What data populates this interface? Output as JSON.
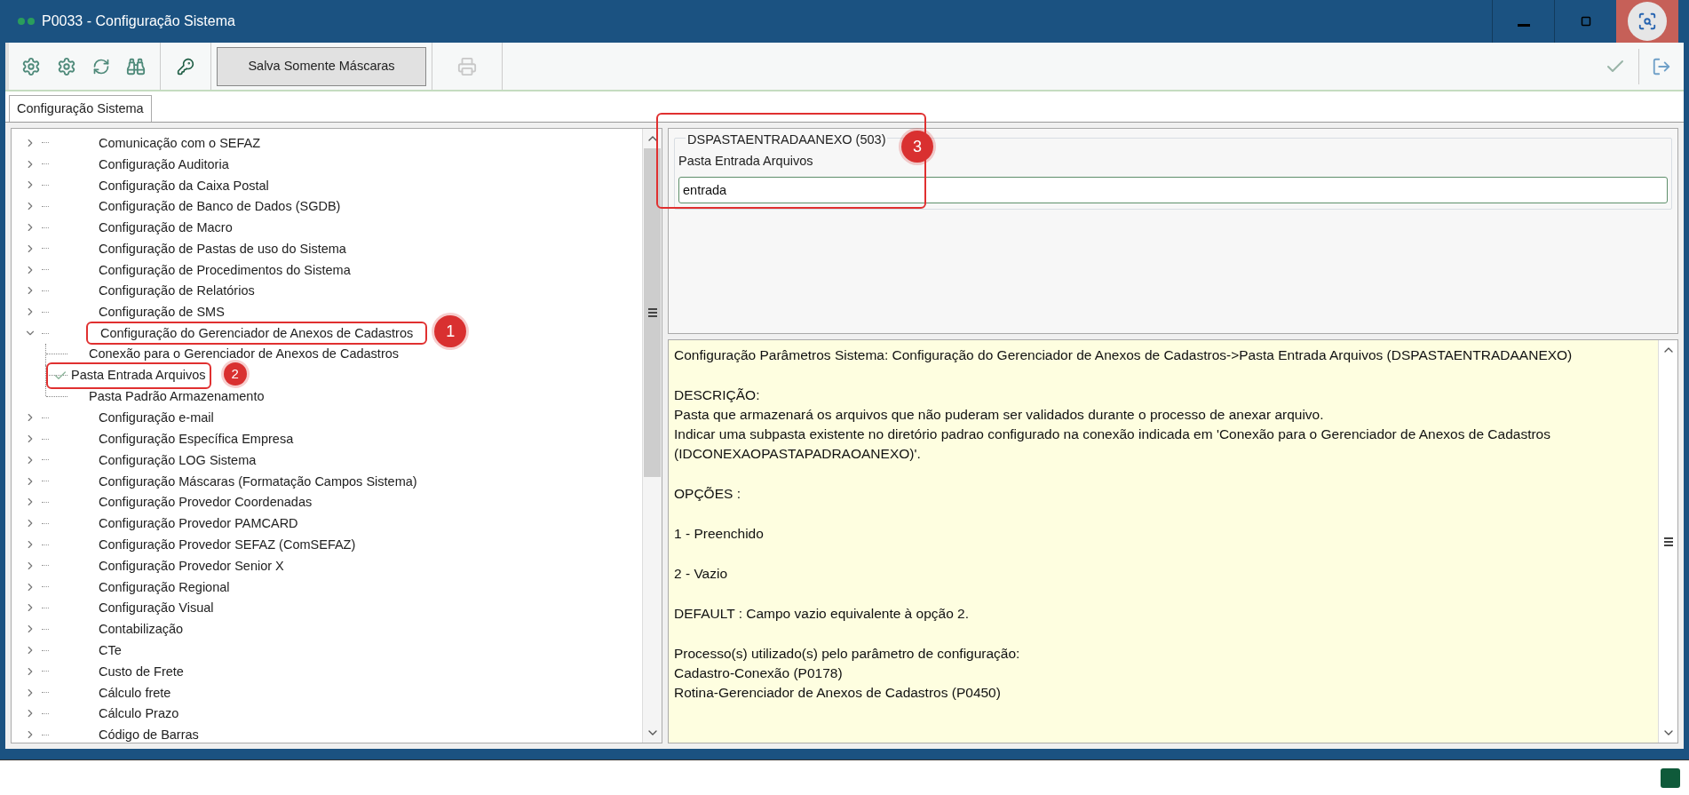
{
  "window": {
    "title": "P0033 - Configuração Sistema"
  },
  "toolbar": {
    "mask_button": "Salva Somente Máscaras",
    "print_disabled": true
  },
  "tabs": [
    {
      "label": "Configuração Sistema",
      "selected": true
    }
  ],
  "tree": {
    "items": [
      {
        "label": "Comunicação com o SEFAZ",
        "expanded": false
      },
      {
        "label": "Configuração Auditoria",
        "expanded": false
      },
      {
        "label": "Configuração da Caixa Postal",
        "expanded": false
      },
      {
        "label": "Configuração de Banco de Dados (SGDB)",
        "expanded": false
      },
      {
        "label": "Configuração de Macro",
        "expanded": false
      },
      {
        "label": "Configuração de Pastas de uso do Sistema",
        "expanded": false
      },
      {
        "label": "Configuração de Procedimentos do Sistema",
        "expanded": false
      },
      {
        "label": "Configuração de Relatórios",
        "expanded": false
      },
      {
        "label": "Configuração de SMS",
        "expanded": false
      },
      {
        "label": "Configuração do Gerenciador de Anexos de Cadastros",
        "expanded": true,
        "annotation": "1",
        "children": [
          {
            "label": "Conexão para o Gerenciador de Anexos de Cadastros",
            "selected": false
          },
          {
            "label": "Pasta Entrada Arquivos",
            "selected": true,
            "annotation": "2"
          },
          {
            "label": "Pasta Padrão Armazenamento",
            "selected": false
          }
        ]
      },
      {
        "label": "Configuração e-mail",
        "expanded": false
      },
      {
        "label": "Configuração Específica Empresa",
        "expanded": false
      },
      {
        "label": "Configuração LOG Sistema",
        "expanded": false
      },
      {
        "label": "Configuração Máscaras (Formatação Campos Sistema)",
        "expanded": false
      },
      {
        "label": "Configuração Provedor Coordenadas",
        "expanded": false
      },
      {
        "label": "Configuração Provedor PAMCARD",
        "expanded": false
      },
      {
        "label": "Configuração Provedor SEFAZ (ComSEFAZ)",
        "expanded": false
      },
      {
        "label": "Configuração Provedor Senior X",
        "expanded": false
      },
      {
        "label": "Configuração Regional",
        "expanded": false
      },
      {
        "label": "Configuração Visual",
        "expanded": false
      },
      {
        "label": "Contabilização",
        "expanded": false
      },
      {
        "label": "CTe",
        "expanded": false
      },
      {
        "label": "Custo de Frete",
        "expanded": false
      },
      {
        "label": "Cálculo frete",
        "expanded": false
      },
      {
        "label": "Cálculo Prazo",
        "expanded": false
      },
      {
        "label": "Código de Barras",
        "expanded": false
      }
    ]
  },
  "parameter": {
    "legend": "DSPASTAENTRADAANEXO (503)",
    "label": "Pasta Entrada Arquivos",
    "value": "entrada",
    "annotation": "3"
  },
  "description": {
    "blocks": [
      [
        "Configuração Parâmetros Sistema: Configuração do Gerenciador de Anexos de Cadastros->Pasta Entrada Arquivos (DSPASTAENTRADAANEXO)"
      ],
      [
        "DESCRIÇÃO:",
        "Pasta que armazenará os arquivos que não puderam ser validados durante o processo de anexar arquivo.",
        "Indicar uma subpasta existente no diretório padrao configurado na conexão indicada em 'Conexão para o Gerenciador de Anexos de Cadastros (IDCONEXAOPASTAPADRAOANEXO)'."
      ],
      [
        "OPÇÕES :"
      ],
      [
        "1 - Preenchido"
      ],
      [
        "2 - Vazio"
      ],
      [
        "DEFAULT : Campo vazio equivalente à opção 2."
      ],
      [
        "Processo(s) utilizado(s) pelo parâmetro de configuração:",
        "Cadastro-Conexão (P0178)",
        "Rotina-Gerenciador de Anexos de Cadastros (P0450)"
      ]
    ]
  }
}
